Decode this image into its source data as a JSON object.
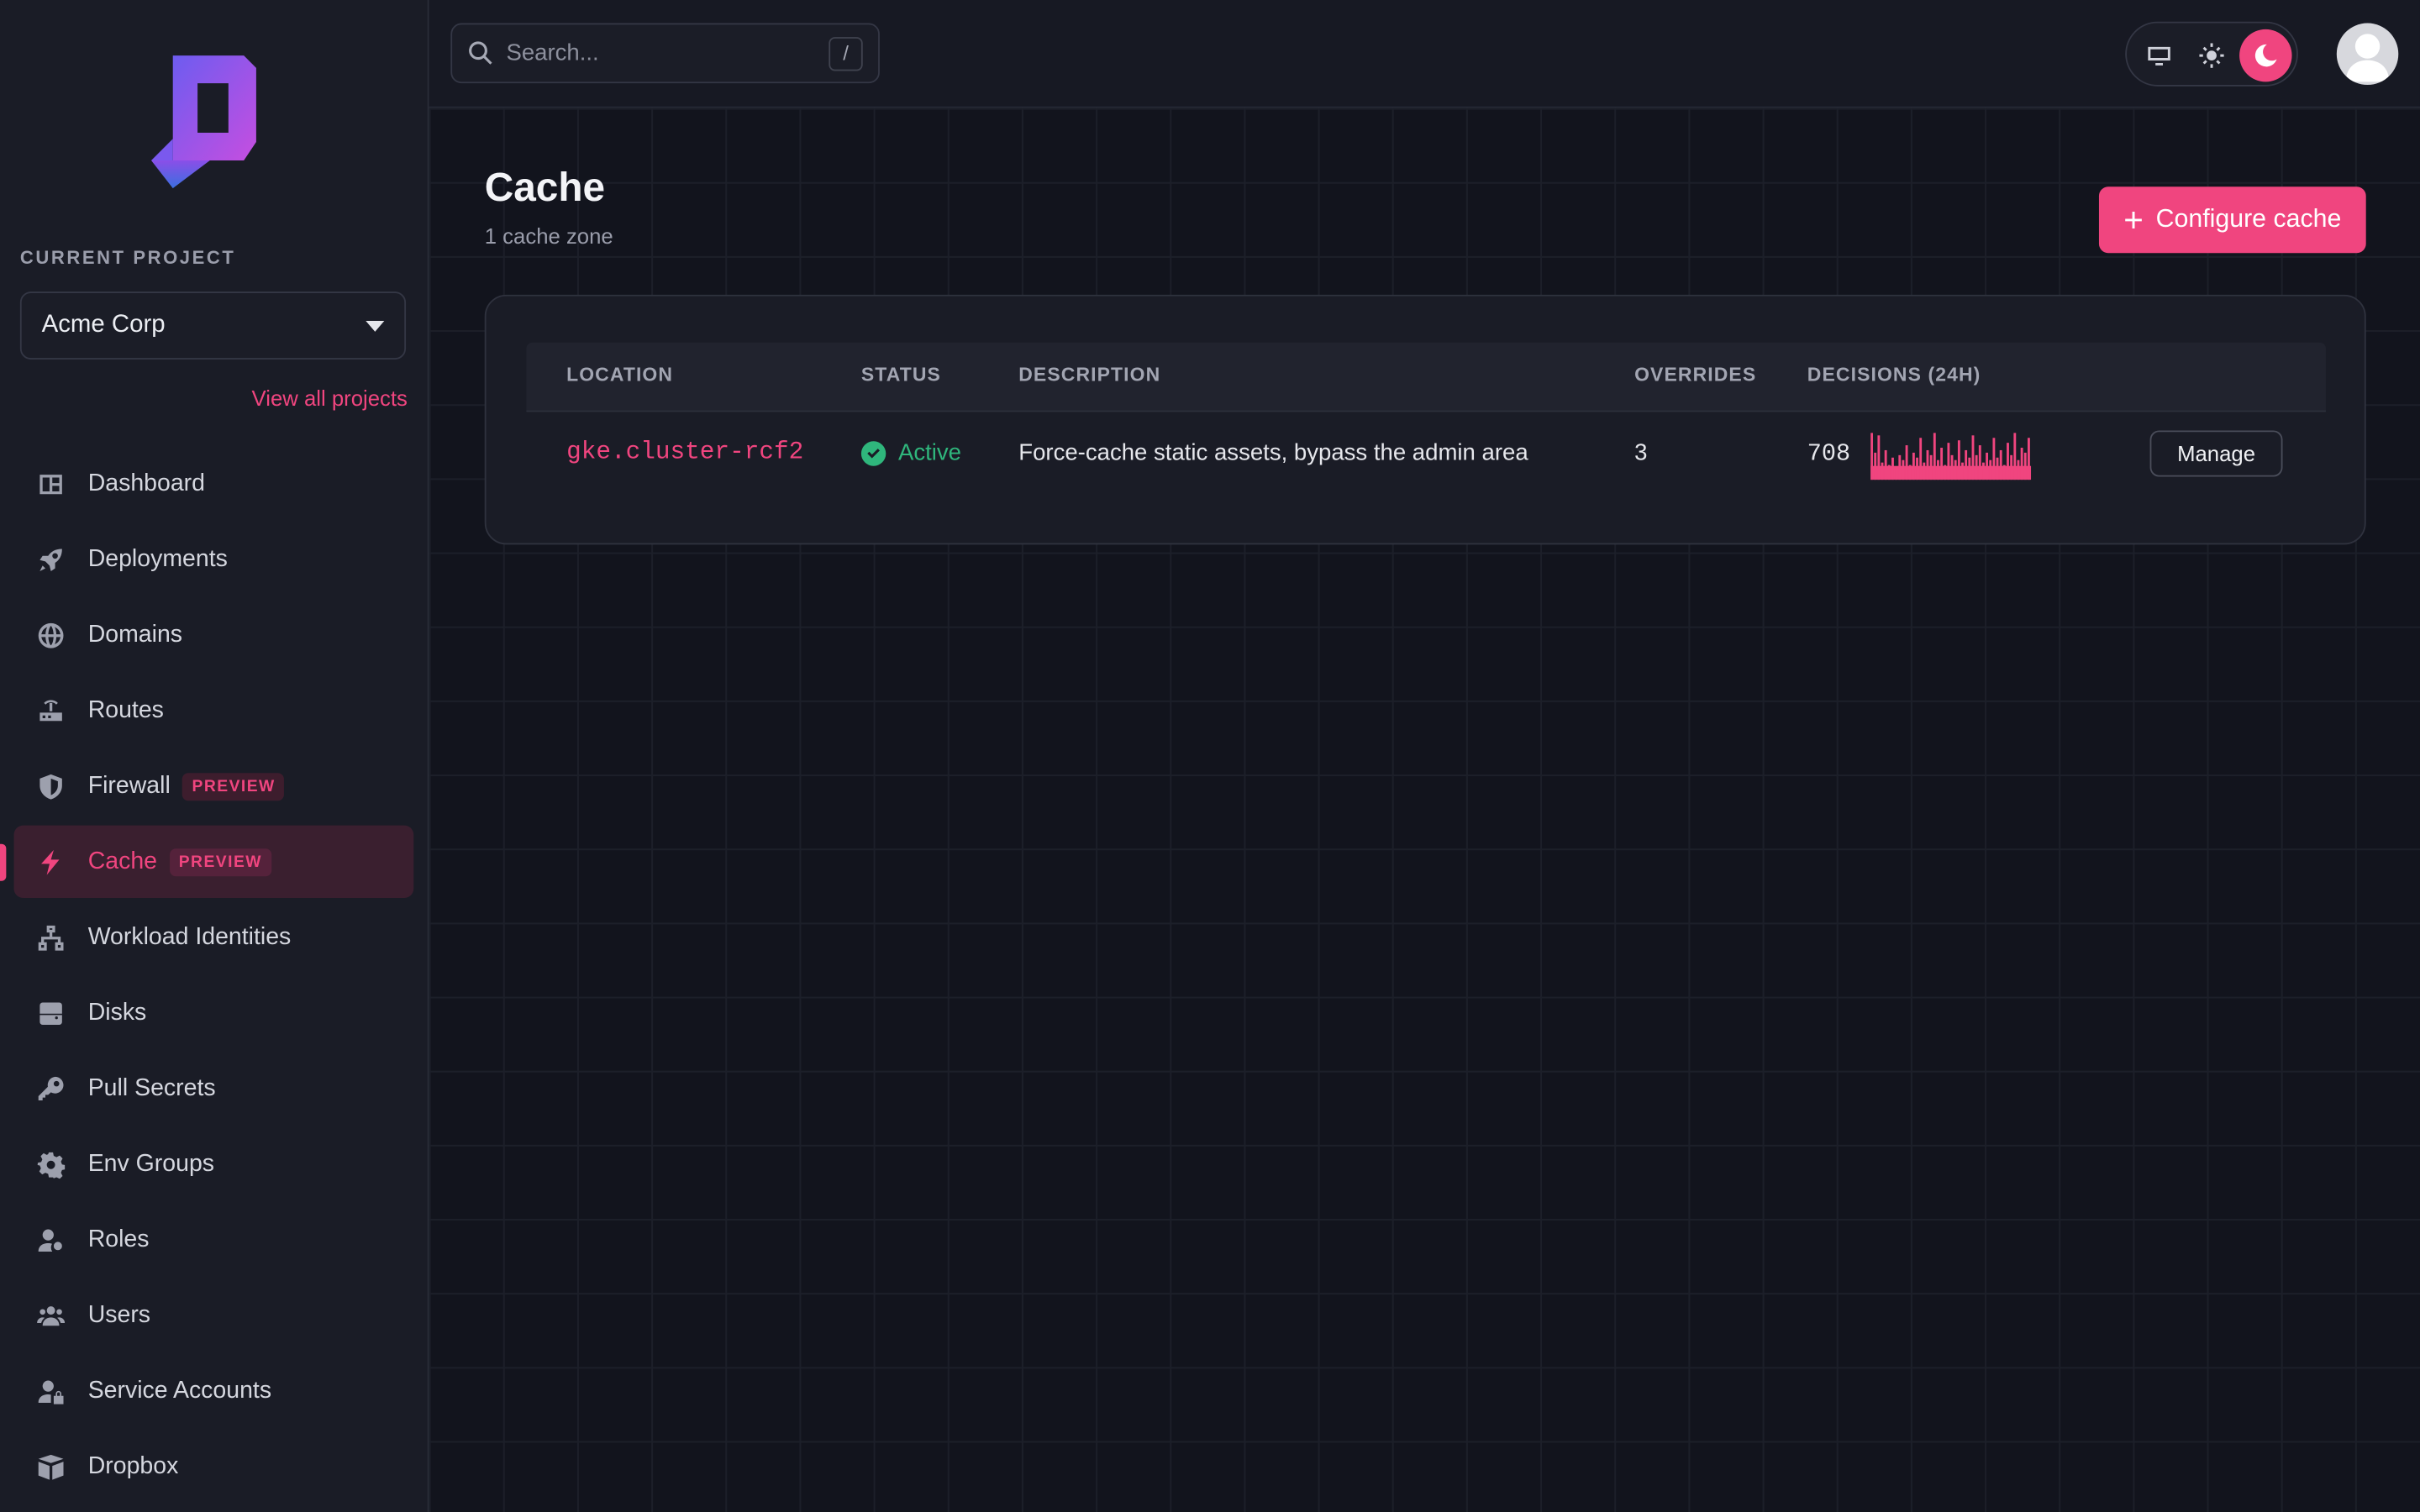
{
  "sidebar": {
    "project_label": "CURRENT PROJECT",
    "project_name": "Acme Corp",
    "view_all": "View all projects",
    "items": [
      {
        "label": "Dashboard",
        "icon": "dashboard-icon"
      },
      {
        "label": "Deployments",
        "icon": "rocket-icon"
      },
      {
        "label": "Domains",
        "icon": "globe-icon"
      },
      {
        "label": "Routes",
        "icon": "router-icon"
      },
      {
        "label": "Firewall",
        "icon": "shield-icon",
        "badge": "PREVIEW"
      },
      {
        "label": "Cache",
        "icon": "bolt-icon",
        "badge": "PREVIEW",
        "active": true
      },
      {
        "label": "Workload Identities",
        "icon": "network-icon"
      },
      {
        "label": "Disks",
        "icon": "disk-icon"
      },
      {
        "label": "Pull Secrets",
        "icon": "key-icon"
      },
      {
        "label": "Env Groups",
        "icon": "gear-icon"
      },
      {
        "label": "Roles",
        "icon": "user-gear-icon"
      },
      {
        "label": "Users",
        "icon": "users-icon"
      },
      {
        "label": "Service Accounts",
        "icon": "user-lock-icon"
      },
      {
        "label": "Dropbox",
        "icon": "box-icon"
      }
    ]
  },
  "topbar": {
    "search_placeholder": "Search...",
    "search_shortcut": "/",
    "theme_options": [
      "system",
      "light",
      "dark"
    ],
    "theme_selected": "dark"
  },
  "page": {
    "title": "Cache",
    "subtitle": "1 cache zone",
    "configure_label": "Configure cache"
  },
  "table": {
    "headers": {
      "location": "LOCATION",
      "status": "STATUS",
      "description": "DESCRIPTION",
      "overrides": "OVERRIDES",
      "decisions": "DECISIONS (24H)"
    },
    "rows": [
      {
        "location": "gke.cluster-rcf2",
        "status": "Active",
        "description": "Force-cache static assets, bypass the admin area",
        "overrides": "3",
        "decisions": "708",
        "manage": "Manage",
        "sparkline": [
          0.95,
          0.55,
          0.9,
          0.35,
          0.6,
          0.3,
          0.45,
          0.25,
          0.5,
          0.4,
          0.7,
          0.3,
          0.55,
          0.45,
          0.85,
          0.35,
          0.6,
          0.5,
          0.95,
          0.4,
          0.65,
          0.3,
          0.75,
          0.5,
          0.4,
          0.8,
          0.35,
          0.6,
          0.45,
          0.9,
          0.5,
          0.7,
          0.35,
          0.55,
          0.4,
          0.85,
          0.45,
          0.6,
          0.3,
          0.75,
          0.5,
          0.95,
          0.4,
          0.65,
          0.55,
          0.85
        ]
      }
    ]
  },
  "colors": {
    "accent": "#f0457f",
    "success": "#2fb67c",
    "background": "#12141d",
    "sidebar": "#1a1c26"
  }
}
